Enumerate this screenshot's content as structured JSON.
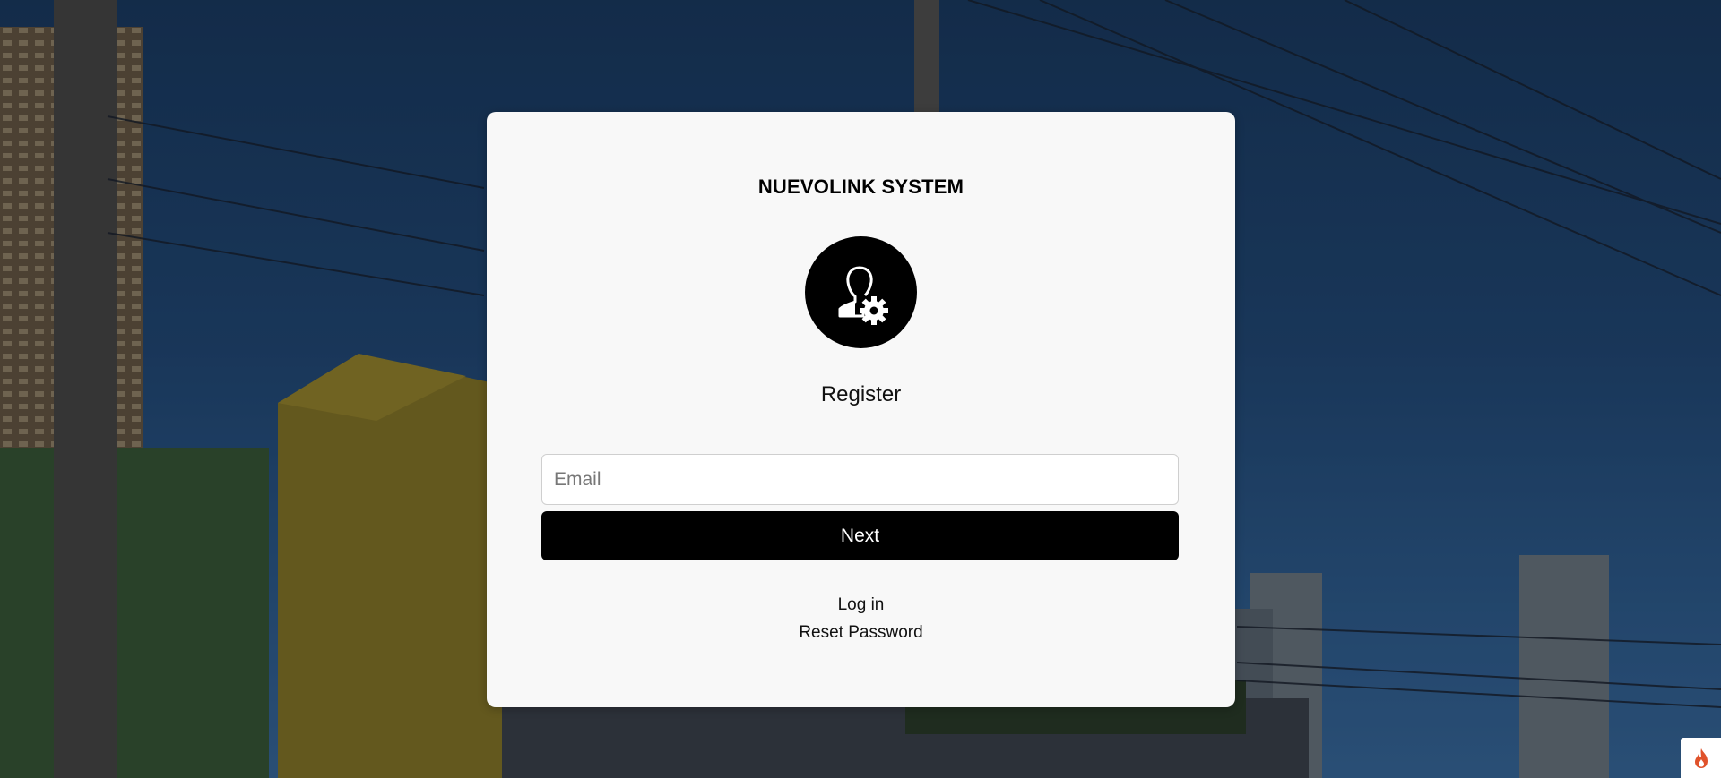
{
  "app": {
    "title": "NUEVOLINK SYSTEM",
    "subtitle": "Register"
  },
  "form": {
    "email_placeholder": "Email",
    "email_value": "",
    "next_label": "Next"
  },
  "links": {
    "login_label": "Log in",
    "reset_label": "Reset Password"
  },
  "icons": {
    "avatar": "user-gear-icon",
    "corner": "flame-icon"
  },
  "colors": {
    "card_bg": "#f8f8f8",
    "button_bg": "#000000",
    "button_text": "#ffffff",
    "corner_icon": "#e0522b"
  }
}
